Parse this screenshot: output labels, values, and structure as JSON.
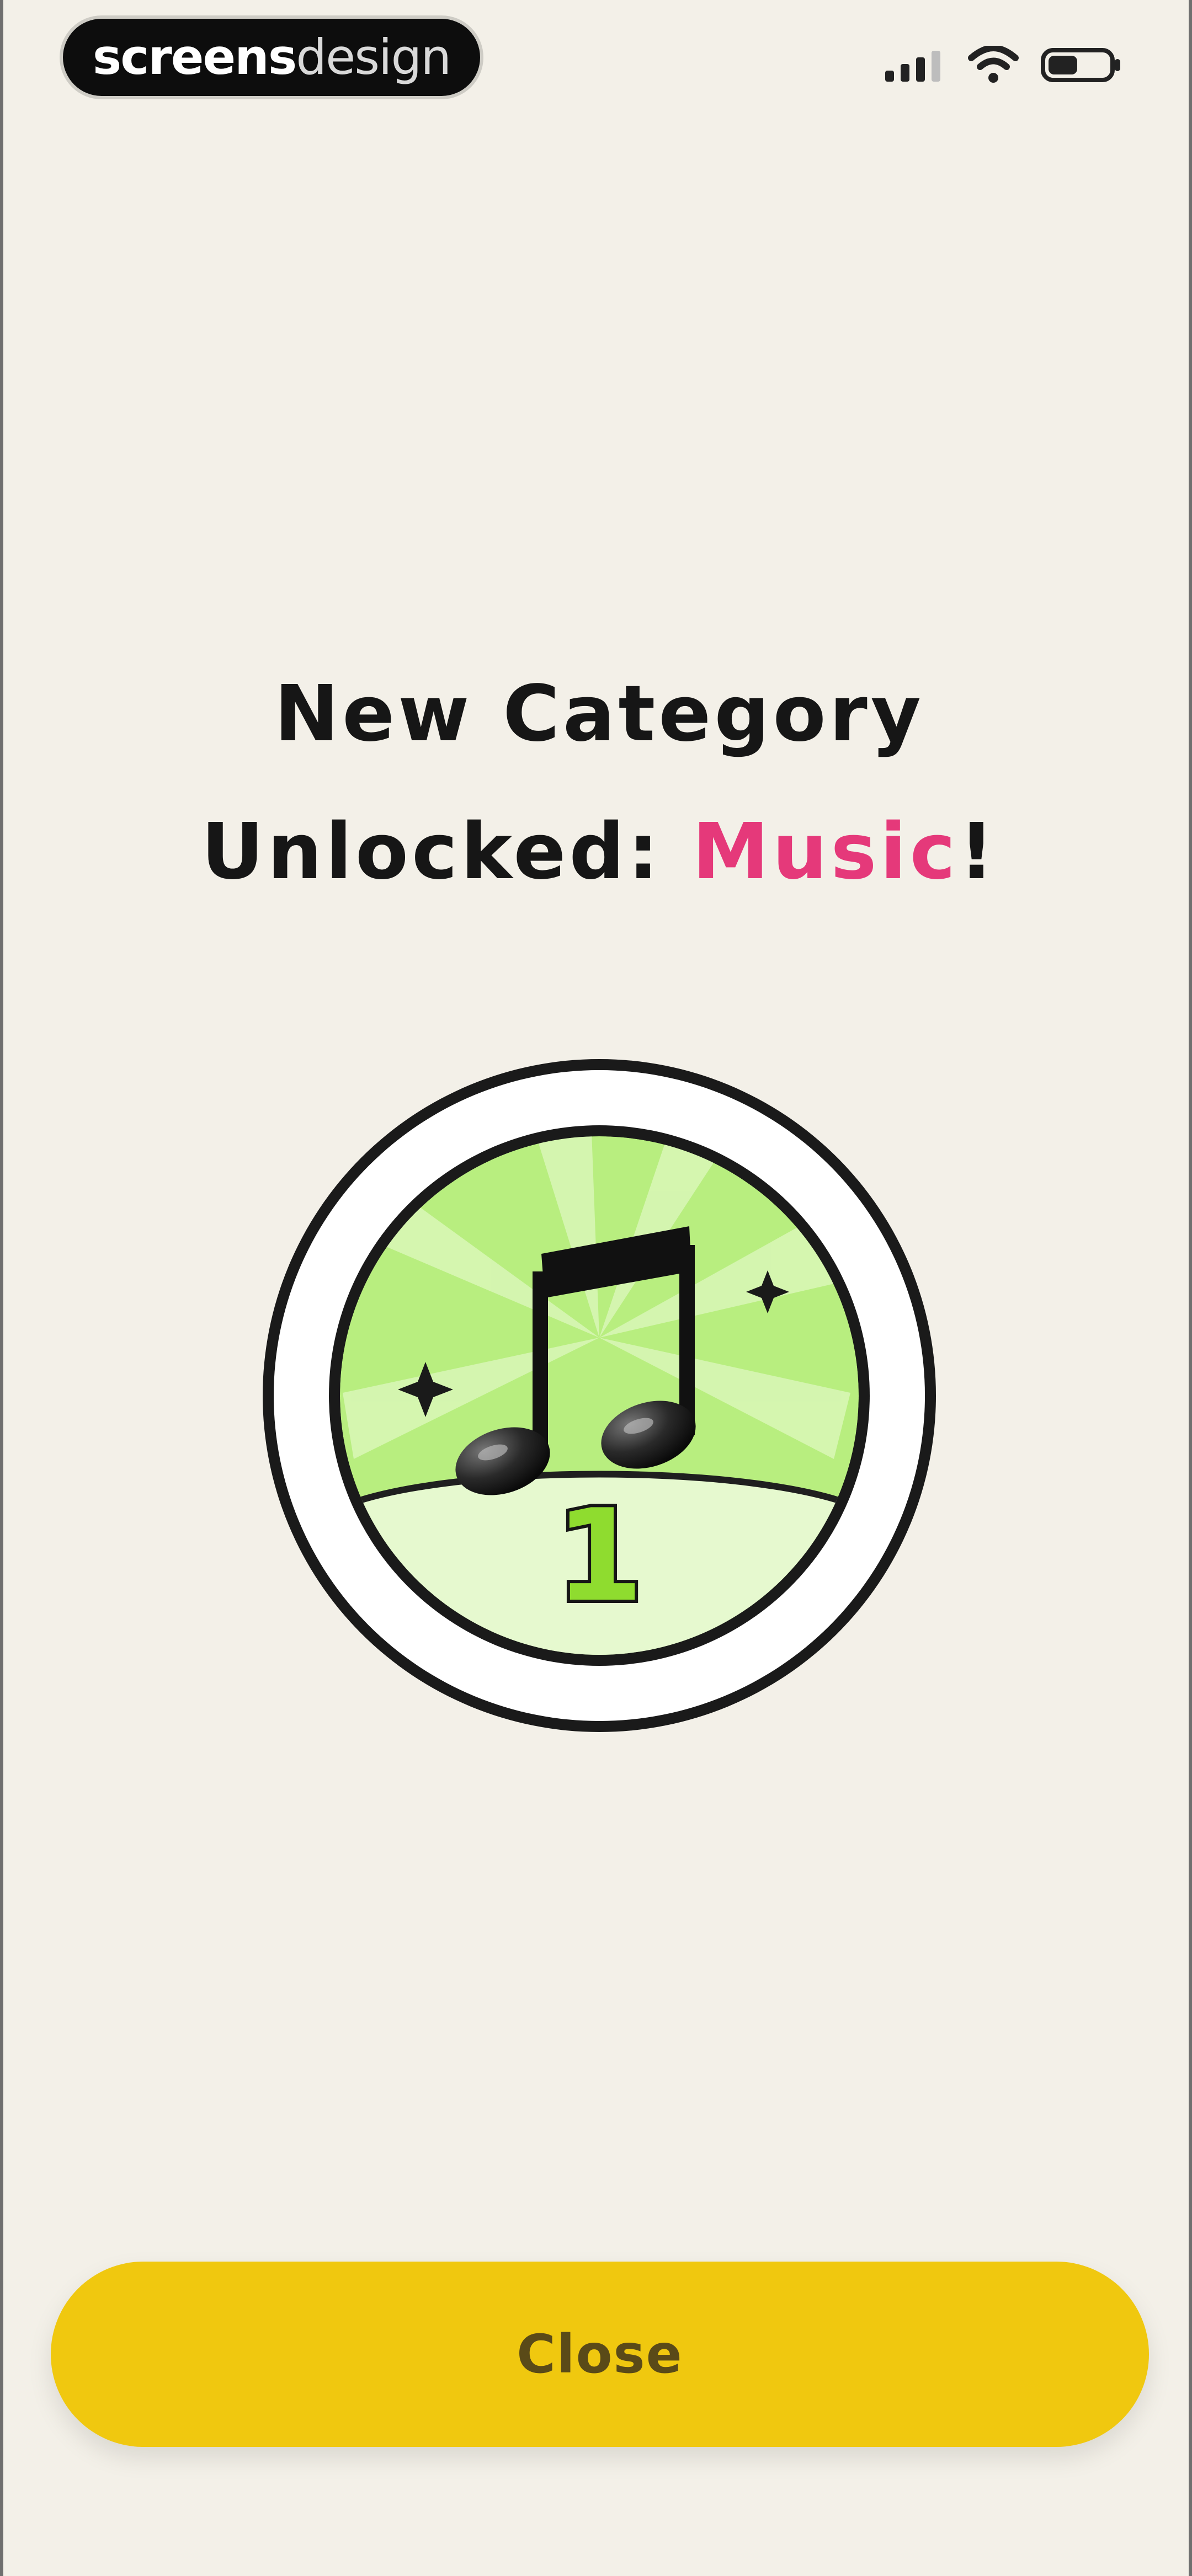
{
  "status_bar": {
    "brand_primary": "screens",
    "brand_secondary": "design",
    "icons": [
      "signal-icon",
      "wifi-icon",
      "battery-icon"
    ]
  },
  "main": {
    "headline_line1": "New Category",
    "headline_line2_prefix": "Unlocked: ",
    "category_name": "Music",
    "headline_suffix": "!",
    "badge": {
      "icon": "music-note-icon",
      "level": "1"
    }
  },
  "actions": {
    "close_label": "Close"
  },
  "colors": {
    "background": "#f3f0e8",
    "accent_pink": "#e5397a",
    "button_yellow": "#f0c80f",
    "badge_green": "#b8ee7f",
    "badge_light_green": "#e6f9cf",
    "level_green": "#8fdc2f"
  }
}
